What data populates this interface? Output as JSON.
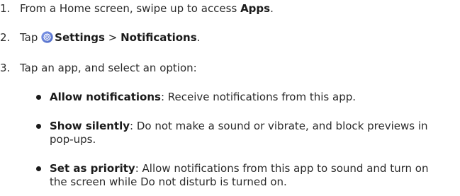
{
  "steps": [
    {
      "number": "1.",
      "text_before": "From a Home screen, swipe up to access ",
      "bold": "Apps",
      "text_after": "."
    },
    {
      "number": "2.",
      "tap": "Tap ",
      "settings_icon": "settings-gear-icon",
      "settings": "Settings",
      "separator": " > ",
      "notifications": "Notifications",
      "end": "."
    },
    {
      "number": "3.",
      "text": "Tap an app, and select an option:"
    }
  ],
  "options": [
    {
      "name": "Allow notifications",
      "description": ": Receive notifications from this app."
    },
    {
      "name": "Show silently",
      "description": ": Do not make a sound or vibrate, and block previews in pop-ups."
    },
    {
      "name": "Set as priority",
      "description": ": Allow notifications from this app to sound and turn on the screen while Do not disturb is turned on."
    }
  ],
  "colors": {
    "text": "#2a2a2a",
    "bold_text": "#1a1a1a",
    "settings_icon_bg": "#5b7bd6"
  }
}
